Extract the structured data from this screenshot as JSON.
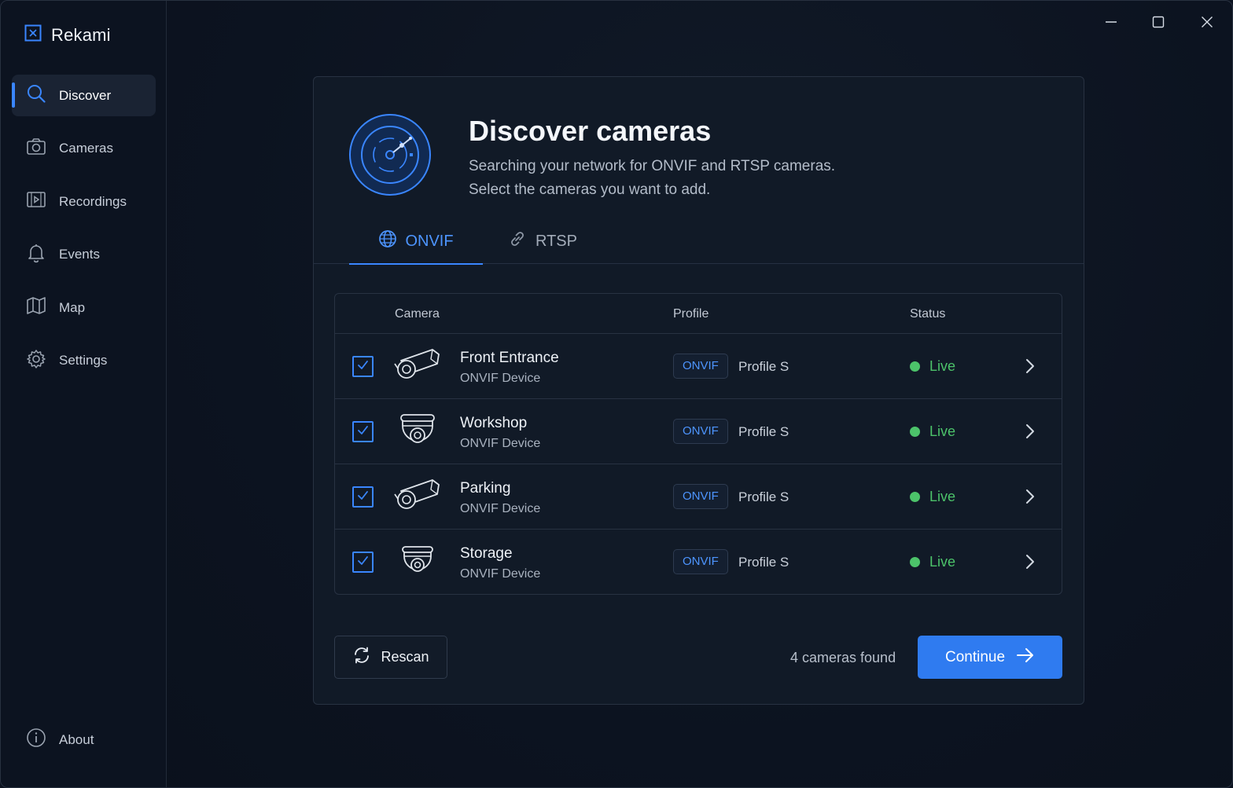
{
  "app": {
    "title": "Rekami"
  },
  "window_controls": {
    "minimize_icon": "minimize-icon",
    "maximize_icon": "maximize-icon",
    "close_icon": "close-icon"
  },
  "sidebar": {
    "items": [
      {
        "label": "Discover",
        "icon": "search-icon",
        "active": true
      },
      {
        "label": "Cameras",
        "icon": "camera-icon"
      },
      {
        "label": "Recordings",
        "icon": "video-play-icon"
      },
      {
        "label": "Events",
        "icon": "bell-icon"
      },
      {
        "label": "Map",
        "icon": "map-icon"
      },
      {
        "label": "Settings",
        "icon": "gear-icon"
      }
    ],
    "about": {
      "label": "About",
      "icon": "info-icon"
    }
  },
  "header": {
    "title": "Discover cameras",
    "subtitle_line1": "Searching your network for ONVIF and RTSP cameras.",
    "subtitle_line2": "Select the cameras you want to add."
  },
  "tabs": [
    {
      "label": "ONVIF",
      "icon": "globe-icon",
      "active": true
    },
    {
      "label": "RTSP",
      "icon": "link-icon"
    }
  ],
  "table": {
    "columns": [
      "Camera",
      "Profile",
      "Status"
    ],
    "rows": [
      {
        "name": "Front Entrance",
        "type": "ONVIF Device",
        "badge": "ONVIF",
        "profile": "Profile S",
        "status": "Live",
        "checked": true,
        "icon": "bullet-camera-icon"
      },
      {
        "name": "Workshop",
        "type": "ONVIF Device",
        "badge": "ONVIF",
        "profile": "Profile S",
        "status": "Live",
        "checked": true,
        "icon": "dome-camera-icon"
      },
      {
        "name": "Parking",
        "type": "ONVIF Device",
        "badge": "ONVIF",
        "profile": "Profile S",
        "status": "Live",
        "checked": true,
        "icon": "bullet-camera-icon"
      },
      {
        "name": "Storage",
        "type": "ONVIF Device",
        "badge": "ONVIF",
        "profile": "Profile S",
        "status": "Live",
        "checked": true,
        "icon": "dome-camera-icon"
      }
    ]
  },
  "footer": {
    "rescan_label": "Rescan",
    "found_text": "4 cameras found",
    "continue_label": "Continue"
  },
  "colors": {
    "accent": "#3a86ff",
    "live": "#4cc36a",
    "background": "#0c1320"
  }
}
